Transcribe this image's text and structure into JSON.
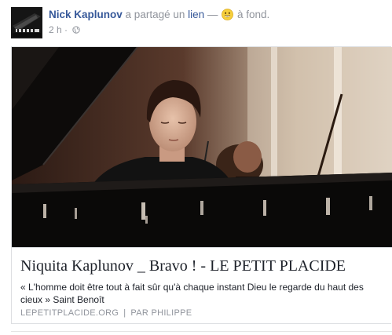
{
  "post": {
    "author": "Nick Kaplunov",
    "action": "a partagé un",
    "link_word": "lien",
    "dash": "—",
    "feeling": "à fond.",
    "emoji_icon": "happy-face-icon",
    "time": "2 h",
    "privacy_icon": "globe-icon"
  },
  "card": {
    "title": "Niquita Kaplunov _ Bravo ! - LE PETIT PLACIDE",
    "description": "« L'homme doit être tout à fait sûr qu'à chaque instant Dieu le regarde du haut des cieux » Saint Benoît",
    "domain": "LEPETITPLACIDE.ORG",
    "separator": "|",
    "author": "PAR PHILIPPE"
  },
  "colors": {
    "author_link": "#365899",
    "secondary_text": "#90949c",
    "card_border": "#dddfe2"
  }
}
